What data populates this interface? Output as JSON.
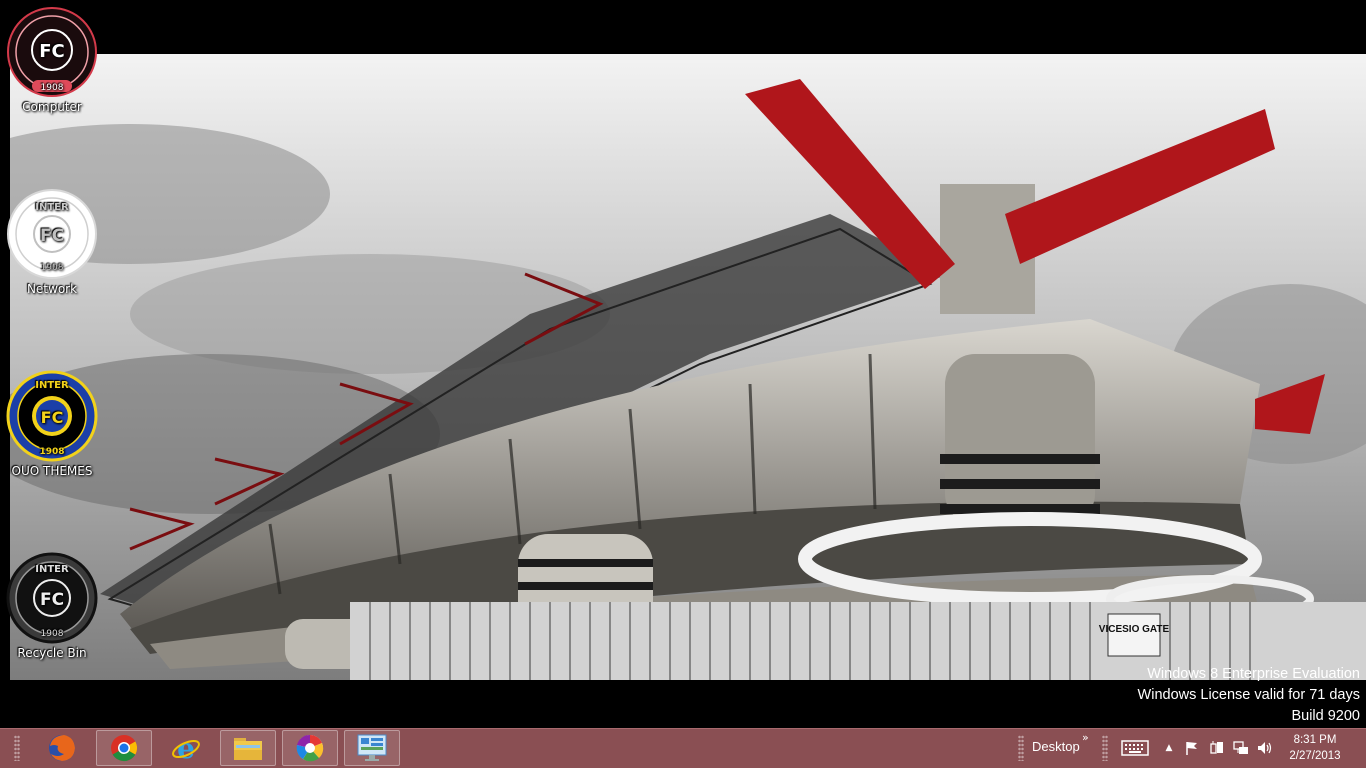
{
  "desktop_icons": [
    {
      "label": "Computer",
      "icon": "computer-icon"
    },
    {
      "label": "Network",
      "icon": "network-icon"
    },
    {
      "label": "OUO THEMES",
      "icon": "ouo-themes-icon"
    },
    {
      "label": "Recycle Bin",
      "icon": "recycle-bin-icon"
    }
  ],
  "badges": {
    "year": "1908",
    "club": "INTER"
  },
  "wallpaper": {
    "gate_sign": "VICESIO GATE"
  },
  "watermark": {
    "line1": "Windows 8 Enterprise Evaluation",
    "line2": "Windows License valid for 71 days",
    "line3": "Build 9200"
  },
  "taskbar": {
    "pinned": [
      {
        "name": "firefox",
        "icon": "firefox-icon"
      },
      {
        "name": "chrome",
        "icon": "chrome-icon"
      },
      {
        "name": "internet-explorer",
        "icon": "internet-explorer-icon"
      },
      {
        "name": "file-explorer",
        "icon": "file-explorer-icon"
      },
      {
        "name": "picasa",
        "icon": "picasa-icon"
      },
      {
        "name": "control-panel",
        "icon": "control-panel-icon"
      }
    ],
    "desktop_toolbar_label": "Desktop",
    "chevron": "»",
    "tray_arrow": "▲"
  },
  "clock": {
    "time": "8:31 PM",
    "date": "2/27/2013"
  },
  "colors": {
    "taskbar": "#8a4f53",
    "inter_blue": "#1b3fa8",
    "inter_yellow": "#f2d21a",
    "stadium_red": "#b0161b"
  }
}
